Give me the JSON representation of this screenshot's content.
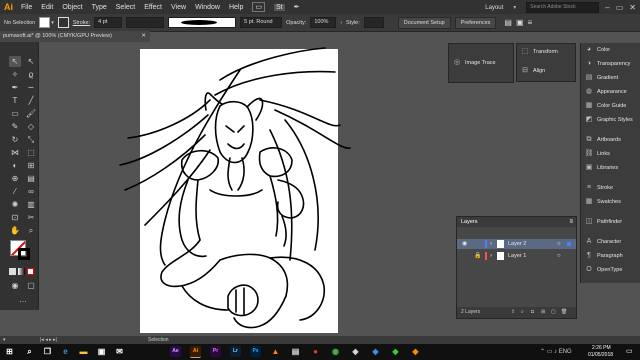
{
  "app": {
    "logo": "Ai"
  },
  "menu": [
    "File",
    "Edit",
    "Object",
    "Type",
    "Select",
    "Effect",
    "View",
    "Window",
    "Help"
  ],
  "window": {
    "workspace": "Layout",
    "search_placeholder": "Search Adobe Stock"
  },
  "control_bar": {
    "selection_status": "No Selection",
    "stroke_label": "Stroke:",
    "stroke_value": "4 pt",
    "brush_value": "5 pt. Round",
    "opacity_label": "Opacity:",
    "opacity_value": "100%",
    "style_label": "Style:",
    "document_setup": "Document Setup",
    "preferences": "Preferences"
  },
  "document_tab": "pumasoft.ai* @ 100% (CMYK/GPU Preview)",
  "panels": {
    "dock1": [
      {
        "label": "Image Trace",
        "icon": "image-trace-icon"
      }
    ],
    "dock2": [
      {
        "label": "Transform",
        "icon": "transform-icon"
      },
      {
        "label": "Align",
        "icon": "align-icon"
      }
    ],
    "dock3": [
      {
        "label": "Color",
        "icon": "color-icon"
      },
      {
        "label": "Transparency",
        "icon": "transparency-icon"
      },
      {
        "label": "Gradient",
        "icon": "gradient-icon"
      },
      {
        "label": "Appearance",
        "icon": "appearance-icon"
      },
      {
        "label": "Color Guide",
        "icon": "color-guide-icon"
      },
      {
        "label": "Graphic Styles",
        "icon": "graphic-styles-icon"
      },
      {
        "label": "Artboards",
        "icon": "artboards-icon"
      },
      {
        "label": "Links",
        "icon": "links-icon"
      },
      {
        "label": "Libraries",
        "icon": "libraries-icon"
      },
      {
        "label": "Stroke",
        "icon": "stroke-icon"
      },
      {
        "label": "Swatches",
        "icon": "swatches-icon"
      },
      {
        "label": "Pathfinder",
        "icon": "pathfinder-icon"
      },
      {
        "label": "Character",
        "icon": "character-icon"
      },
      {
        "label": "Paragraph",
        "icon": "paragraph-icon"
      },
      {
        "label": "OpenType",
        "icon": "opentype-icon"
      }
    ]
  },
  "layers": {
    "title": "Layers",
    "rows": [
      {
        "name": "Layer 2",
        "color": "#4f7fff",
        "visible": true,
        "selected": true
      },
      {
        "name": "Layer 1",
        "color": "#ff4f4f",
        "visible": false,
        "locked": true,
        "selected": false
      }
    ],
    "footer": "2 Layers"
  },
  "status_bar": {
    "tool": "Selection"
  },
  "taskbar": {
    "time": "2:26 PM",
    "date": "01/05/2018",
    "apps": [
      {
        "label": "Ae",
        "color": "#2a0a4a",
        "fg": "#d9a7ff"
      },
      {
        "label": "Ai",
        "color": "#3a1d00",
        "fg": "#ff9a00"
      },
      {
        "label": "Pr",
        "color": "#2a0a3a",
        "fg": "#e077ff"
      },
      {
        "label": "Lr",
        "color": "#0a1f33",
        "fg": "#7ad0ff"
      },
      {
        "label": "Ps",
        "color": "#001e36",
        "fg": "#31a8ff"
      }
    ]
  }
}
